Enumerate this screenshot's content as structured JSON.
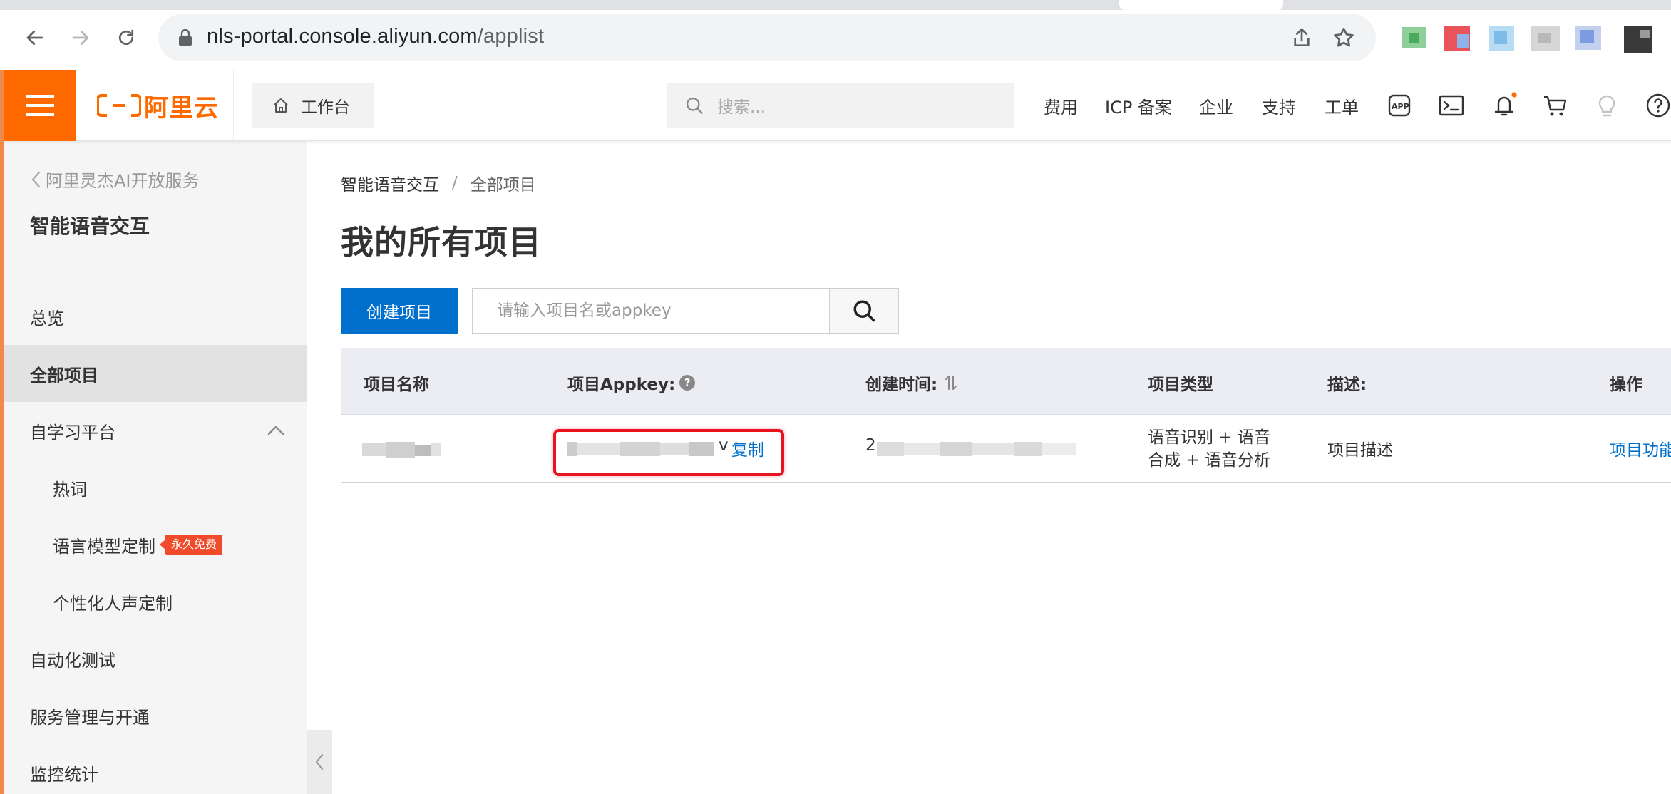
{
  "browser": {
    "url_host": "nls-portal.console.aliyun.com",
    "url_path": "/applist"
  },
  "topbar": {
    "brand": "阿里云",
    "workbench": "工作台",
    "search_placeholder": "搜索...",
    "nav": [
      "费用",
      "ICP 备案",
      "企业",
      "支持",
      "工单"
    ],
    "accent": "#ff6a00"
  },
  "sidebar": {
    "back_label": "阿里灵杰AI开放服务",
    "title": "智能语音交互",
    "items": [
      {
        "label": "总览"
      },
      {
        "label": "全部项目",
        "active": true
      },
      {
        "label": "自学习平台",
        "expanded": true
      },
      {
        "label": "热词",
        "sub": true
      },
      {
        "label": "语言模型定制",
        "sub": true,
        "badge": "永久免费"
      },
      {
        "label": "个性化人声定制",
        "sub": true
      },
      {
        "label": "自动化测试"
      },
      {
        "label": "服务管理与开通"
      },
      {
        "label": "监控统计"
      }
    ]
  },
  "breadcrumb": {
    "parent": "智能语音交互",
    "separator": "/",
    "current": "全部项目"
  },
  "page": {
    "title": "我的所有项目",
    "create_button": "创建项目",
    "search_placeholder": "请输入项目名或appkey",
    "primary_color": "#0070cc"
  },
  "table": {
    "headers": {
      "name": "项目名称",
      "appkey": "项目Appkey:",
      "created": "创建时间:",
      "type": "项目类型",
      "desc": "描述:",
      "actions": "操作"
    },
    "rows": [
      {
        "appkey_suffix": "v",
        "copy_label": "复制",
        "created_prefix": "2",
        "type_line1": "语音识别 + 语音",
        "type_line2": "合成 + 语音分析",
        "desc": "项目描述",
        "action": "项目功能"
      }
    ]
  }
}
